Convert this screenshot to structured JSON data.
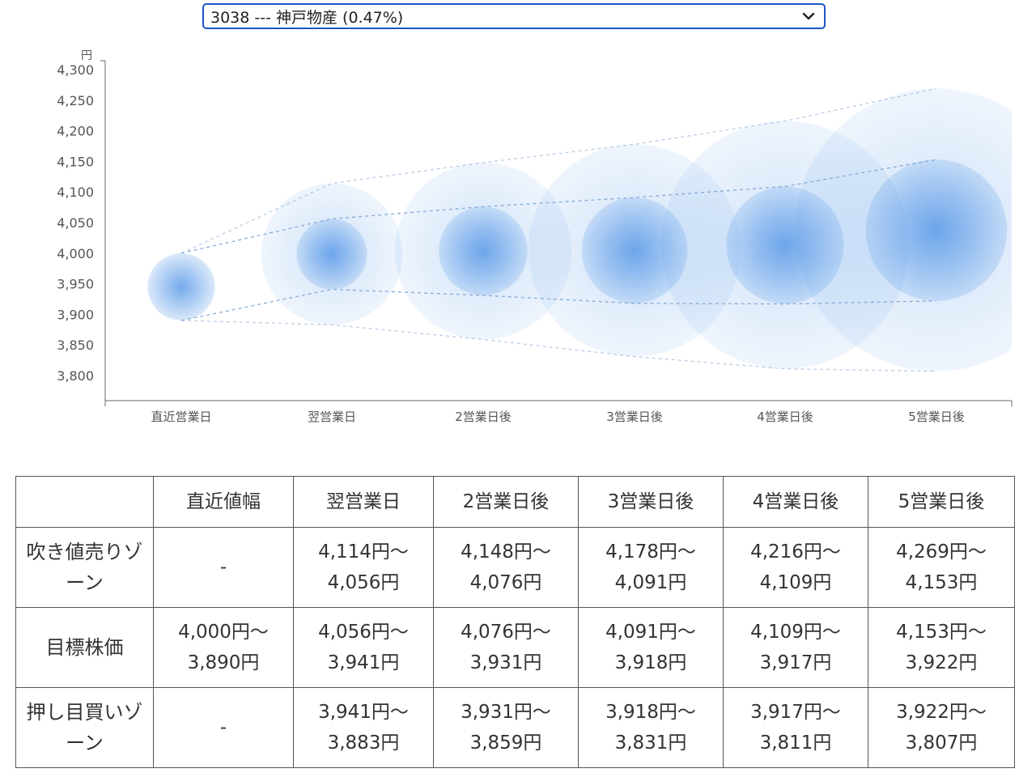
{
  "selector": {
    "selected": "3038 --- 神戸物産 (0.47%)",
    "chevron_icon": "chevron-down-icon"
  },
  "chart_data": {
    "type": "bubble-band",
    "unit": "円",
    "categories": [
      "直近営業日",
      "翌営業日",
      "2営業日後",
      "3営業日後",
      "4営業日後",
      "5営業日後"
    ],
    "ylim": [
      3800,
      4300
    ],
    "yticks": [
      "4,300",
      "4,250",
      "4,200",
      "4,150",
      "4,100",
      "4,050",
      "4,000",
      "3,950",
      "3,900",
      "3,850",
      "3,800"
    ],
    "upper_outer": [
      4000,
      4114,
      4148,
      4178,
      4216,
      4269
    ],
    "upper_inner": [
      4000,
      4056,
      4076,
      4091,
      4109,
      4153
    ],
    "lower_inner": [
      3890,
      3941,
      3931,
      3918,
      3917,
      3922
    ],
    "lower_outer": [
      3890,
      3883,
      3859,
      3831,
      3811,
      3807
    ],
    "colors": {
      "bubble": "#5b9be8",
      "line": "#7fa6d6",
      "axis": "#666666"
    }
  },
  "table": {
    "headers": [
      "",
      "直近値幅",
      "翌営業日",
      "2営業日後",
      "3営業日後",
      "4営業日後",
      "5営業日後"
    ],
    "rows": [
      {
        "label": "吹き値売りゾーン",
        "cells": [
          [
            "-"
          ],
          [
            "4,114円〜",
            "4,056円"
          ],
          [
            "4,148円〜",
            "4,076円"
          ],
          [
            "4,178円〜",
            "4,091円"
          ],
          [
            "4,216円〜",
            "4,109円"
          ],
          [
            "4,269円〜",
            "4,153円"
          ]
        ]
      },
      {
        "label": "目標株価",
        "cells": [
          [
            "4,000円〜",
            "3,890円"
          ],
          [
            "4,056円〜",
            "3,941円"
          ],
          [
            "4,076円〜",
            "3,931円"
          ],
          [
            "4,091円〜",
            "3,918円"
          ],
          [
            "4,109円〜",
            "3,917円"
          ],
          [
            "4,153円〜",
            "3,922円"
          ]
        ]
      },
      {
        "label": "押し目買いゾーン",
        "cells": [
          [
            "-"
          ],
          [
            "3,941円〜",
            "3,883円"
          ],
          [
            "3,931円〜",
            "3,859円"
          ],
          [
            "3,918円〜",
            "3,831円"
          ],
          [
            "3,917円〜",
            "3,811円"
          ],
          [
            "3,922円〜",
            "3,807円"
          ]
        ]
      }
    ]
  }
}
